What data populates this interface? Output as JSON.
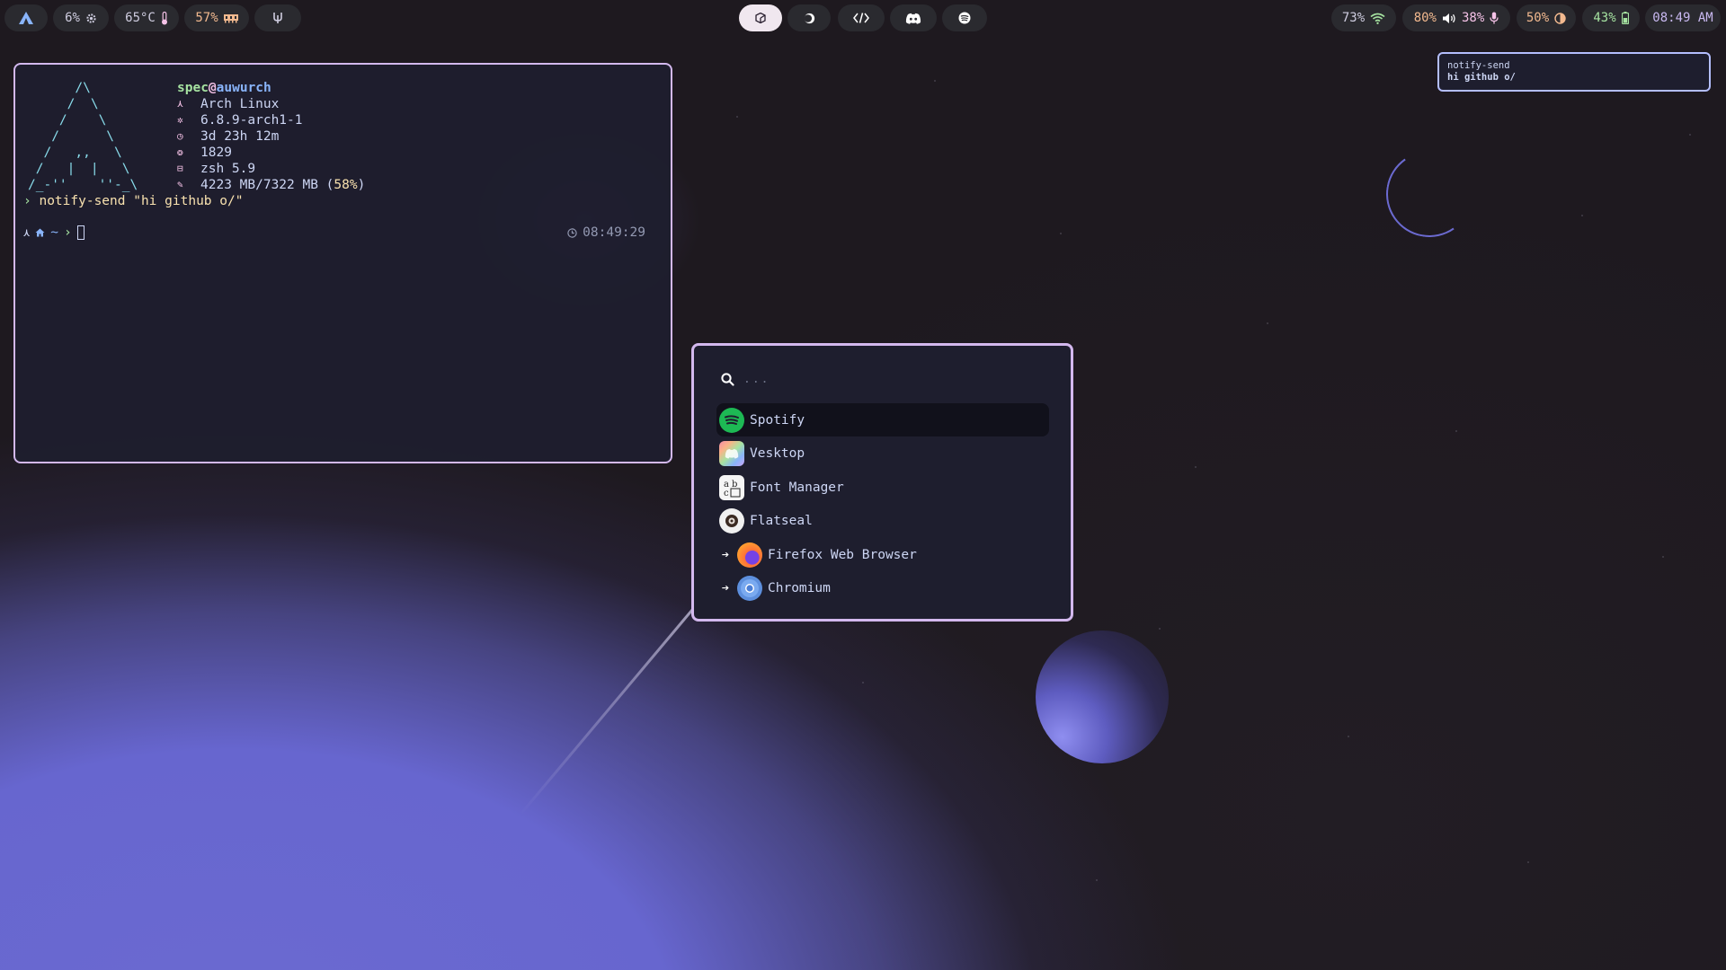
{
  "topbar": {
    "left": {
      "arch_icon": "arch-logo-icon",
      "cpu": {
        "value": "6%",
        "icon": "gear-icon"
      },
      "temp": {
        "value": "65°C",
        "icon": "thermometer-icon"
      },
      "mem": {
        "value": "57%",
        "icon": "memory-icon"
      },
      "misc_icon": "pinned-icon"
    },
    "center": [
      {
        "name": "workspace-1",
        "icon": "cube-icon",
        "active": true
      },
      {
        "name": "workspace-2",
        "icon": "half-moon-icon",
        "active": false
      },
      {
        "name": "workspace-3",
        "icon": "code-icon",
        "active": false
      },
      {
        "name": "workspace-4",
        "icon": "discord-icon",
        "active": false
      },
      {
        "name": "workspace-5",
        "icon": "spotify-icon",
        "active": false
      }
    ],
    "right": {
      "wifi": {
        "value": "73%",
        "icon": "wifi-icon"
      },
      "volume": {
        "value": "80%",
        "icon": "speaker-icon"
      },
      "mic": {
        "value": "38%",
        "icon": "microphone-icon"
      },
      "brightness": {
        "value": "50%",
        "icon": "brightness-icon"
      },
      "battery": {
        "value": "43%",
        "icon": "battery-icon"
      },
      "clock": "08:49 AM"
    }
  },
  "terminal": {
    "ascii_art": "      /\\\n     /  \\\n    /    \\\n   /      \\\n  /   ,,   \\\n /   |  |   \\\n/_-''    ''-_\\",
    "user": "spec",
    "at": "@",
    "host": "auwurch",
    "fetch": [
      {
        "icon": "arch-icon",
        "value": "Arch Linux"
      },
      {
        "icon": "kernel-icon",
        "value": "6.8.9-arch1-1"
      },
      {
        "icon": "uptime-icon",
        "value": "3d 23h 12m"
      },
      {
        "icon": "packages-icon",
        "value": "1829"
      },
      {
        "icon": "shell-icon",
        "value": "zsh 5.9"
      }
    ],
    "memory": {
      "used": "4223 MB/7322 MB (",
      "percent": "58%",
      "close": ")"
    },
    "command_prompt": "›",
    "command": "notify-send \"hi github o/\"",
    "prompt": {
      "arch": "⋏",
      "home": "~",
      "arrow": "›"
    },
    "right_time": "08:49:29"
  },
  "notification": {
    "app": "notify-send",
    "body": "hi github o/"
  },
  "launcher": {
    "search_placeholder": "...",
    "entries": [
      {
        "label": "Spotify",
        "icon": "spotify-app-icon",
        "selected": true,
        "arrow": false
      },
      {
        "label": "Vesktop",
        "icon": "vesktop-app-icon",
        "selected": false,
        "arrow": false
      },
      {
        "label": "Font Manager",
        "icon": "font-manager-app-icon",
        "selected": false,
        "arrow": false
      },
      {
        "label": "Flatseal",
        "icon": "flatseal-app-icon",
        "selected": false,
        "arrow": false
      },
      {
        "label": "Firefox Web Browser",
        "icon": "firefox-app-icon",
        "selected": false,
        "arrow": true
      },
      {
        "label": "Chromium",
        "icon": "chromium-app-icon",
        "selected": false,
        "arrow": true
      }
    ]
  },
  "colors": {
    "accent_border": "#d3b8ee",
    "wallpaper_purple": "#6b6ad0",
    "bar_pill": "#2a2a2f",
    "active_pill": "#f0e7ef",
    "terminal_bg": "#1e1e2e"
  }
}
